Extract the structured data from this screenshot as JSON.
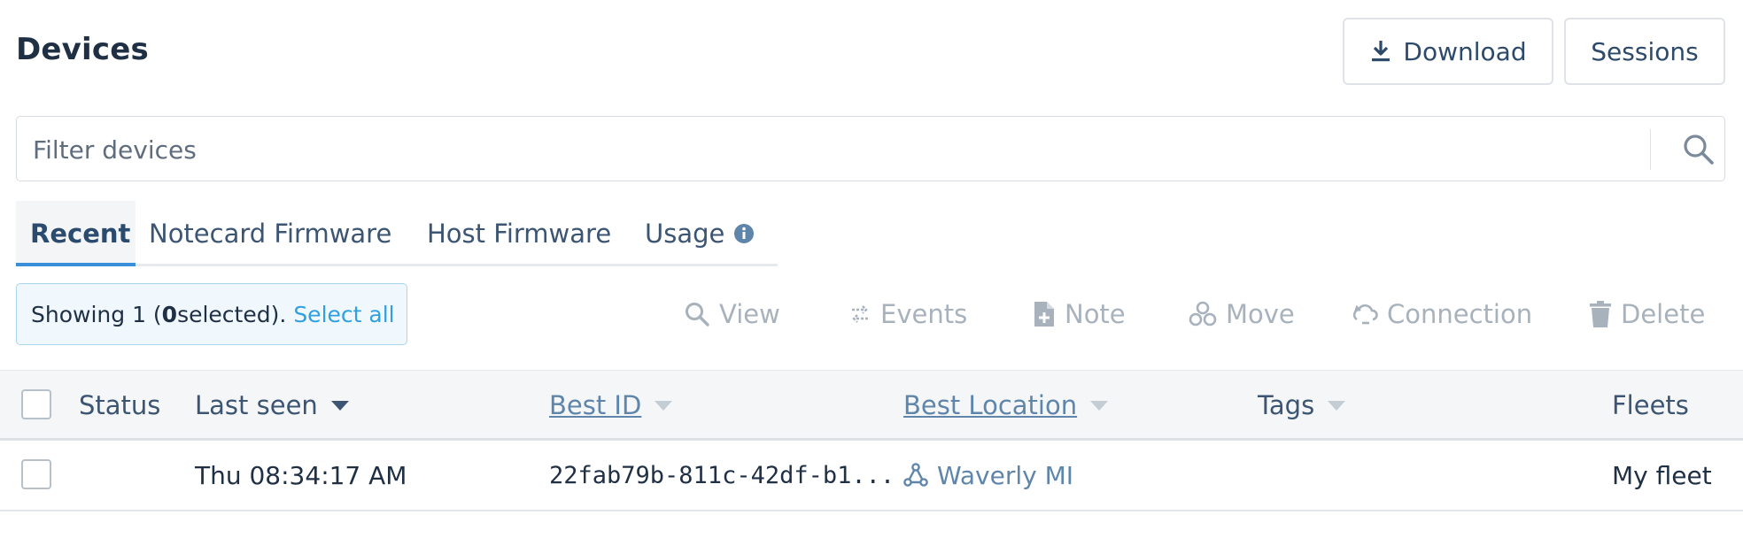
{
  "header": {
    "title": "Devices",
    "download_label": "Download",
    "sessions_label": "Sessions"
  },
  "search": {
    "placeholder": "Filter devices",
    "value": ""
  },
  "tabs": [
    {
      "label": "Recent",
      "active": true
    },
    {
      "label": "Notecard Firmware",
      "active": false
    },
    {
      "label": "Host Firmware",
      "active": false
    },
    {
      "label": "Usage",
      "active": false
    }
  ],
  "selection": {
    "prefix": "Showing 1 (",
    "count": "0",
    "suffix": " selected).",
    "select_all": "Select all"
  },
  "actions": {
    "view": "View",
    "events": "Events",
    "note": "Note",
    "move": "Move",
    "connection": "Connection",
    "delete": "Delete"
  },
  "table": {
    "columns": {
      "status": "Status",
      "last_seen": "Last seen",
      "best_id": "Best ID",
      "best_location": "Best Location",
      "tags": "Tags",
      "fleets": "Fleets"
    },
    "rows": [
      {
        "status": "",
        "last_seen": "Thu 08:34:17 AM",
        "best_id": "22fab79b-811c-42df-b1...",
        "best_location": "Waverly MI",
        "tags": "",
        "fleets": "My fleet"
      }
    ]
  },
  "colors": {
    "accent": "#3a8fd9",
    "link": "#2fa0e0",
    "disabled": "#a8b2bd",
    "heading": "#1f2f44"
  },
  "icons": {
    "download": "download-icon",
    "search": "search-icon",
    "info": "info-icon",
    "view": "magnifier-icon",
    "events": "arrows-swap-icon",
    "note": "note-add-icon",
    "move": "hexagons-icon",
    "connection": "cloud-sync-icon",
    "delete": "trash-icon",
    "location": "triangulation-icon"
  }
}
